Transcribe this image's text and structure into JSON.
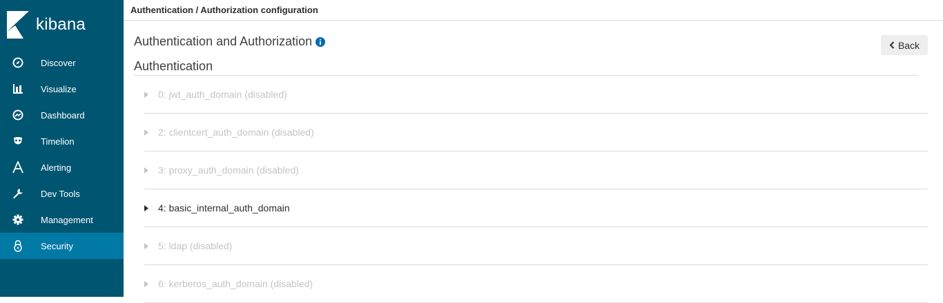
{
  "app": {
    "name": "kibana"
  },
  "sidebar": {
    "items": [
      {
        "label": "Discover",
        "icon": "compass-icon",
        "active": false
      },
      {
        "label": "Visualize",
        "icon": "bar-chart-icon",
        "active": false
      },
      {
        "label": "Dashboard",
        "icon": "dashboard-gauge-icon",
        "active": false
      },
      {
        "label": "Timelion",
        "icon": "timelion-mask-icon",
        "active": false
      },
      {
        "label": "Alerting",
        "icon": "alerting-a-icon",
        "active": false
      },
      {
        "label": "Dev Tools",
        "icon": "wrench-icon",
        "active": false
      },
      {
        "label": "Management",
        "icon": "gear-icon",
        "active": false
      },
      {
        "label": "Security",
        "icon": "lock-icon",
        "active": true
      }
    ]
  },
  "breadcrumb": "Authentication / Authorization configuration",
  "main": {
    "title": "Authentication and Authorization",
    "back_label": "Back",
    "section_title": "Authentication",
    "domains": [
      {
        "label": "0: jwt_auth_domain (disabled)",
        "enabled": false
      },
      {
        "label": "2: clientcert_auth_domain (disabled)",
        "enabled": false
      },
      {
        "label": "3: proxy_auth_domain (disabled)",
        "enabled": false
      },
      {
        "label": "4: basic_internal_auth_domain",
        "enabled": true
      },
      {
        "label": "5: ldap (disabled)",
        "enabled": false
      },
      {
        "label": "6: kerberos_auth_domain (disabled)",
        "enabled": false
      }
    ]
  },
  "colors": {
    "sidebar_bg": "#005571",
    "sidebar_active": "#0079a5",
    "disabled_text": "#c4c4c4",
    "info_icon": "#006bb4"
  }
}
